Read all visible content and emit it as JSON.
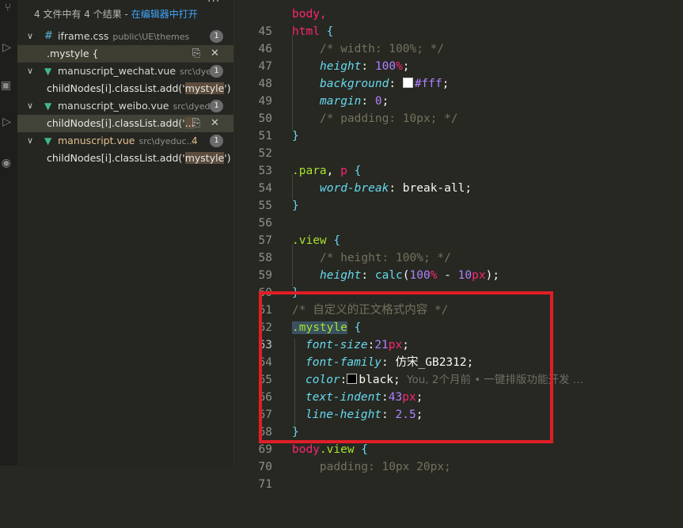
{
  "colors": {
    "accent": "#3ea6ff",
    "highlight_box": "#e01e26",
    "editor_bg": "#272822",
    "sidebar_bg": "#252621"
  },
  "activity_bar": {
    "icons": [
      "source-control-icon",
      "run-icon",
      "extensions-icon",
      "remote-icon",
      "account-icon"
    ]
  },
  "search": {
    "more_actions": "···",
    "summary": "4 文件中有 4 个结果 - ",
    "open_in_editor": "在编辑器中打开",
    "results": [
      {
        "file": "iframe.css",
        "path": "public\\UE\\themes",
        "count": "1",
        "icon": "#",
        "match_text": ".mystyle {",
        "match_prefix": "",
        "match_hit": "",
        "match_suffix": ""
      },
      {
        "file": "manuscript_wechat.vue",
        "path": "src\\dye...",
        "count": "1",
        "icon": "V",
        "match_prefix": "childNodes[i].classList.add('",
        "match_hit": "mystyle",
        "match_suffix": "')"
      },
      {
        "file": "manuscript_weibo.vue",
        "path": "src\\dyed...",
        "count": "1",
        "icon": "V",
        "match_prefix": "childNodes[i].classList.add('",
        "match_hit": "...",
        "match_suffix": ""
      },
      {
        "file": "manuscript.vue",
        "path": "src\\dyeduc...",
        "modified": "4",
        "count": "1",
        "icon": "V",
        "match_prefix": "childNodes[i].classList.add('",
        "match_hit": "mystyle",
        "match_suffix": "')"
      }
    ],
    "actions": {
      "replace_icon": "⎘",
      "dismiss_icon": "✕"
    }
  },
  "editor": {
    "line_numbers": [
      "45",
      "46",
      "47",
      "48",
      "49",
      "50",
      "51",
      "52",
      "53",
      "54",
      "55",
      "56",
      "57",
      "58",
      "59",
      "60",
      "61",
      "62",
      "63",
      "64",
      "65",
      "66",
      "67",
      "68",
      "69",
      "70",
      "71"
    ],
    "lines": {
      "l45": "body,",
      "l46_sel": "html",
      "l46_brace": " {",
      "l47": "/* width: 100%; */",
      "l48_prop": "height",
      "l48_num": "100",
      "l48_unit": "%",
      "l49_prop": "background",
      "l49_val": "#fff",
      "l50_prop": "margin",
      "l50_num": "0",
      "l51": "/* padding: 10px; */",
      "l52": "}",
      "l54_sel1": ".para",
      "l54_sep": ", ",
      "l54_sel2": "p",
      "l54_brace": " {",
      "l55_prop": "word-break",
      "l55_val": "break-all",
      "l56": "}",
      "l58_sel": ".view",
      "l58_brace": " {",
      "l59": "/* height: 100%; */",
      "l60_prop": "height",
      "l60_fn": "calc",
      "l60_num1": "100",
      "l60_unit1": "%",
      "l60_op": " - ",
      "l60_num2": "10",
      "l60_unit2": "px",
      "l61": "}",
      "l62": "/* 自定义的正文格式内容 */",
      "l63_sel": ".mystyle",
      "l63_brace": " {",
      "l63_lens": "You, 2个月前 • 一键排版功能开发 …",
      "l64_prop": "font-size",
      "l64_num": "21",
      "l64_unit": "px",
      "l65_prop": "font-family",
      "l65_val": "仿宋_GB2312",
      "l66_prop": "color",
      "l66_val": "black",
      "l67_prop": "text-indent",
      "l67_num": "43",
      "l67_unit": "px",
      "l68_prop": "line-height",
      "l68_num": "2.5",
      "l69": "}",
      "l70_sel1": "body",
      "l70_sel2": ".view",
      "l70_brace": " {",
      "l71": "    padding: 10px 20px;"
    }
  }
}
